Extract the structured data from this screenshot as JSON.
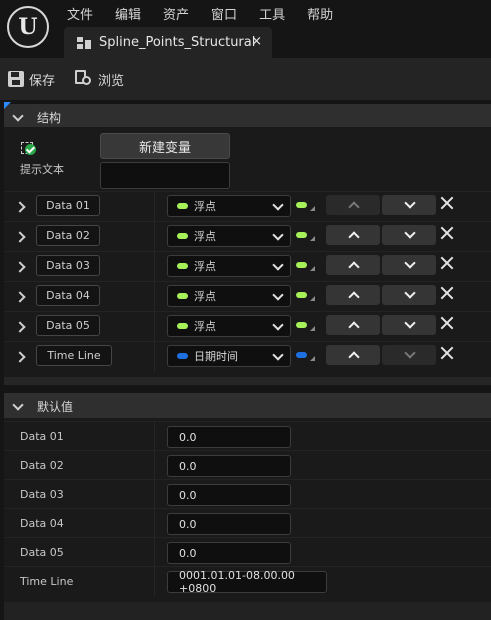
{
  "menu": [
    "文件",
    "编辑",
    "资产",
    "窗口",
    "工具",
    "帮助"
  ],
  "tab": {
    "title": "Spline_Points_Structural",
    "close": "×"
  },
  "toolbar": {
    "save": "保存",
    "browse": "浏览"
  },
  "structure": {
    "title": "结构",
    "new_variable": "新建变量",
    "tooltip_label": "提示文本",
    "rows": [
      {
        "name": "Data 01",
        "type": "浮点",
        "color": "#a6f05a",
        "up_enabled": false,
        "down_enabled": true
      },
      {
        "name": "Data 02",
        "type": "浮点",
        "color": "#a6f05a",
        "up_enabled": true,
        "down_enabled": true
      },
      {
        "name": "Data 03",
        "type": "浮点",
        "color": "#a6f05a",
        "up_enabled": true,
        "down_enabled": true
      },
      {
        "name": "Data 04",
        "type": "浮点",
        "color": "#a6f05a",
        "up_enabled": true,
        "down_enabled": true
      },
      {
        "name": "Data 05",
        "type": "浮点",
        "color": "#a6f05a",
        "up_enabled": true,
        "down_enabled": true
      },
      {
        "name": "Time Line",
        "type": "日期时间",
        "color": "#1e6fe0",
        "up_enabled": true,
        "down_enabled": false
      }
    ]
  },
  "defaults": {
    "title": "默认值",
    "rows": [
      {
        "label": "Data 01",
        "value": "0.0"
      },
      {
        "label": "Data 02",
        "value": "0.0"
      },
      {
        "label": "Data 03",
        "value": "0.0"
      },
      {
        "label": "Data 04",
        "value": "0.0"
      },
      {
        "label": "Data 05",
        "value": "0.0"
      },
      {
        "label": "Time Line",
        "value": "0001.01.01-08.00.00 +0800"
      }
    ]
  }
}
